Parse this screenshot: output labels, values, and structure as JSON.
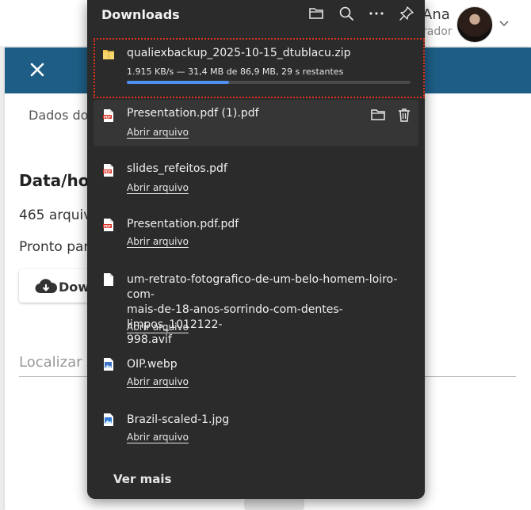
{
  "background": {
    "user_name": "Ana",
    "user_role": "rador",
    "tab_label": "Dados do",
    "heading": "Data/hor",
    "line1": "465 arquiv",
    "line2": "Pronto par",
    "button_label": "Dowr",
    "search_placeholder": "Localizar A",
    "header_color": "#1e5e86"
  },
  "downloads": {
    "title": "Downloads",
    "toolbar_icons": [
      "folder-icon",
      "search-icon",
      "more-icon",
      "pin-icon"
    ],
    "active": {
      "filename": "qualiexbackup_2025-10-15_dtublacu.zip",
      "progress_text": "1.915 KB/s — 31,4 MB de 86,9 MB, 29 s restantes",
      "progress_fraction": 0.36,
      "icon": "zip-folder-icon"
    },
    "items": [
      {
        "filename": "Presentation.pdf (1).pdf",
        "link": "Abrir arquivo",
        "icon": "pdf-icon"
      },
      {
        "filename": "slides_refeitos.pdf",
        "link": "Abrir arquivo",
        "icon": "pdf-icon"
      },
      {
        "filename": "Presentation.pdf.pdf",
        "link": "Abrir arquivo",
        "icon": "pdf-icon"
      },
      {
        "filename_lines": [
          "um-retrato-fotografico-de-um-belo-homem-loiro-com-",
          "mais-de-18-anos-sorrindo-com-dentes-limpos_1012122-",
          "998.avif"
        ],
        "link": "Abrir arquivo",
        "icon": "file-icon"
      },
      {
        "filename": "OIP.webp",
        "link": "Abrir arquivo",
        "icon": "image-icon"
      },
      {
        "filename": "Brazil-scaled-1.jpg",
        "link": "Abrir arquivo",
        "icon": "image-icon"
      }
    ],
    "see_more": "Ver mais",
    "accent": "#4f8ff0",
    "highlight": "#e0321c"
  }
}
